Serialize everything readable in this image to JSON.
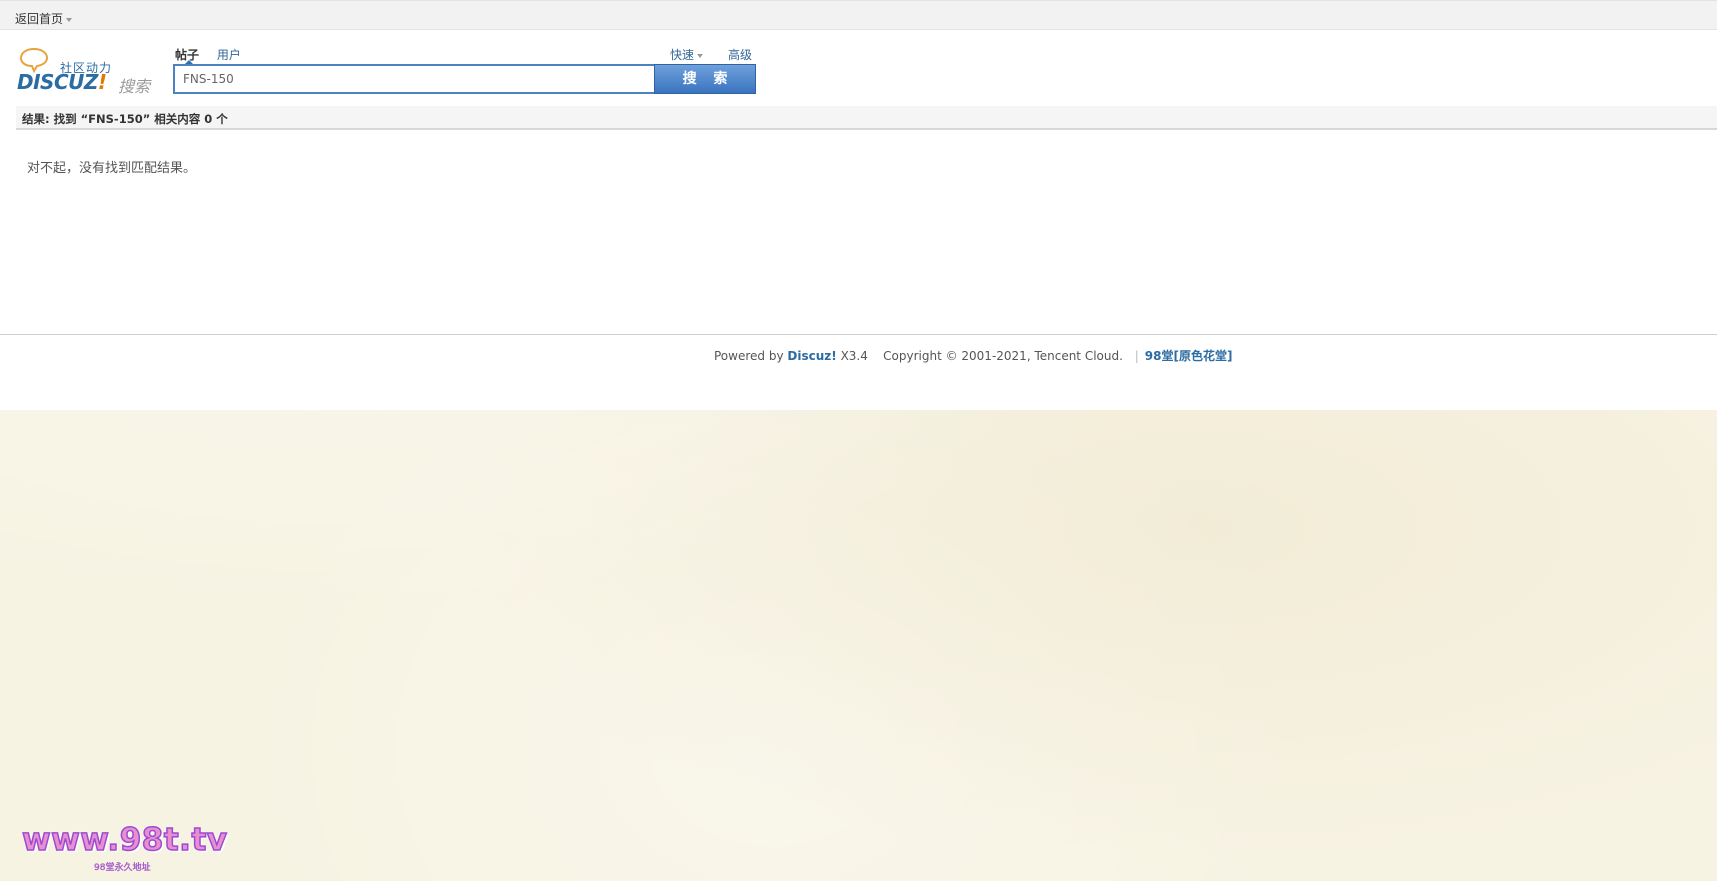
{
  "topbar": {
    "home_label": "返回首页"
  },
  "logo": {
    "slogan": "社区动力",
    "brand": "DISCUZ",
    "brand_mark": "!",
    "sub": "搜索"
  },
  "search": {
    "tabs": [
      {
        "label": "帖子",
        "active": true
      },
      {
        "label": "用户",
        "active": false
      }
    ],
    "quick_label": "快速",
    "advanced_label": "高级",
    "query_value": "FNS-150",
    "button_label": "搜 索"
  },
  "results": {
    "summary": "结果: 找到 “FNS-150” 相关内容 0 个",
    "empty_message": "对不起，没有找到匹配结果。"
  },
  "footer": {
    "powered_prefix": "Powered by",
    "powered_brand": "Discuz!",
    "version": "X3.4",
    "copyright": "Copyright © 2001-2021, Tencent Cloud.",
    "separator": "|",
    "site_name": "98堂[原色花堂]"
  },
  "watermark": {
    "main": "www.98t.tv",
    "sub": "98堂永久地址"
  },
  "colors": {
    "accent": "#2b6ca3",
    "search_button": "#3a74c0",
    "background_paper": "#f7f3e3"
  }
}
